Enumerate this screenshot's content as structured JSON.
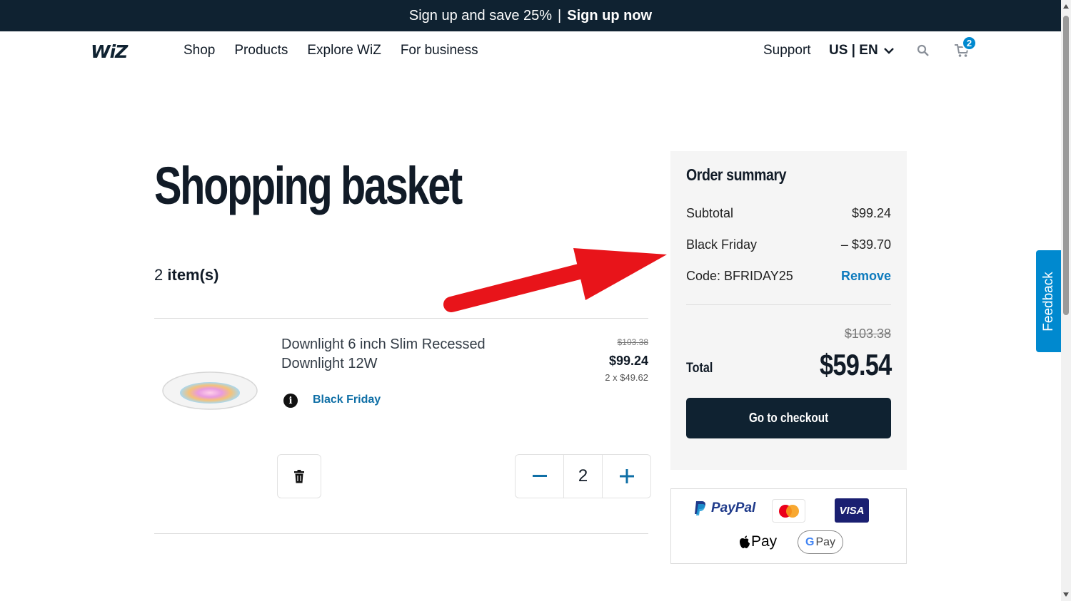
{
  "promo": {
    "text": "Sign up and save 25%",
    "separator": "|",
    "cta": "Sign up now"
  },
  "header": {
    "logo": "WiZ",
    "nav": [
      "Shop",
      "Products",
      "Explore WiZ",
      "For business"
    ],
    "support": "Support",
    "locale": "US | EN",
    "cart_count": "2"
  },
  "basket": {
    "title": "Shopping basket",
    "item_count": "2",
    "item_count_label": "item(s)"
  },
  "item": {
    "name": "Downlight 6 inch Slim Recessed Downlight 12W",
    "promotion": "Black Friday",
    "original_price": "$103.38",
    "price": "$99.24",
    "unit_price": "2 x $49.62",
    "quantity": "2"
  },
  "summary": {
    "title": "Order summary",
    "subtotal_label": "Subtotal",
    "subtotal_value": "$99.24",
    "discount_label": "Black Friday",
    "discount_value": "– $39.70",
    "code_label": "Code: BFRIDAY25",
    "remove_label": "Remove",
    "total_original": "$103.38",
    "total_label": "Total",
    "total_value": "$59.54",
    "checkout_label": "Go to checkout"
  },
  "payments": {
    "paypal": "PayPal",
    "visa": "VISA",
    "applepay": "Pay",
    "gpay": "Pay"
  },
  "feedback": "Feedback",
  "colors": {
    "navy": "#0f2231",
    "accent": "#0089cf",
    "link": "#0f7bbd",
    "arrow": "#e8141a"
  }
}
